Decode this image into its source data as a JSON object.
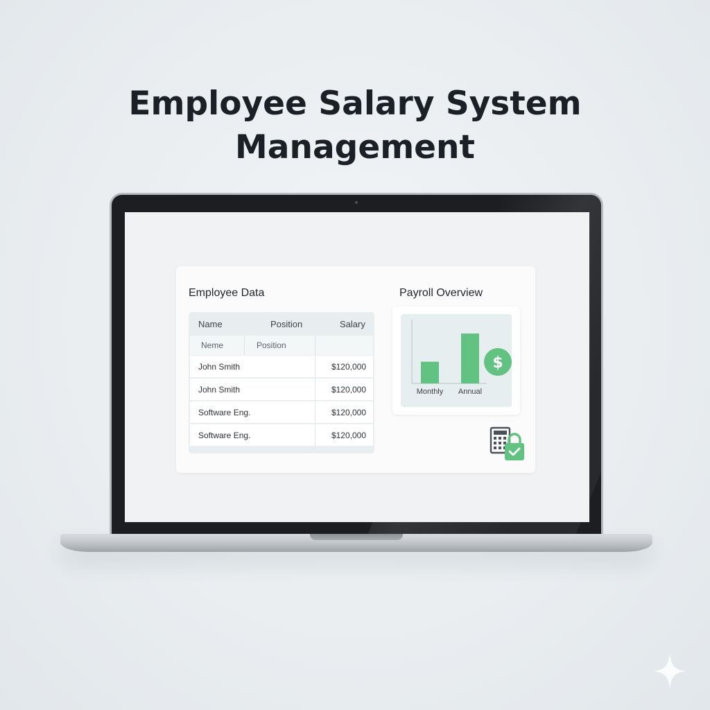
{
  "title": {
    "line1": "Employee Salary System",
    "line2": "Management"
  },
  "employee_data": {
    "title": "Employee Data",
    "columns": [
      "Name",
      "Position",
      "Salary"
    ],
    "subheader": [
      "Neme",
      "Position"
    ],
    "rows": [
      {
        "name": "John Smith",
        "salary": "$120,000"
      },
      {
        "name": "John Smith",
        "salary": "$120,000"
      },
      {
        "name": "Software Eng.",
        "salary": "$120,000"
      },
      {
        "name": "Software Eng.",
        "salary": "$120,000"
      }
    ]
  },
  "payroll": {
    "title": "Payroll Overview",
    "currency_badge": "$"
  },
  "colors": {
    "accent": "#62c282",
    "title": "#1b1f26"
  },
  "icons": [
    "calculator-icon",
    "lock-icon",
    "checkmark-icon",
    "dollar-badge-icon",
    "sparkle-icon"
  ],
  "chart_data": {
    "type": "bar",
    "categories": [
      "Monthly",
      "Annual"
    ],
    "values": [
      10,
      23
    ],
    "title": "",
    "xlabel": "",
    "ylabel": ""
  }
}
